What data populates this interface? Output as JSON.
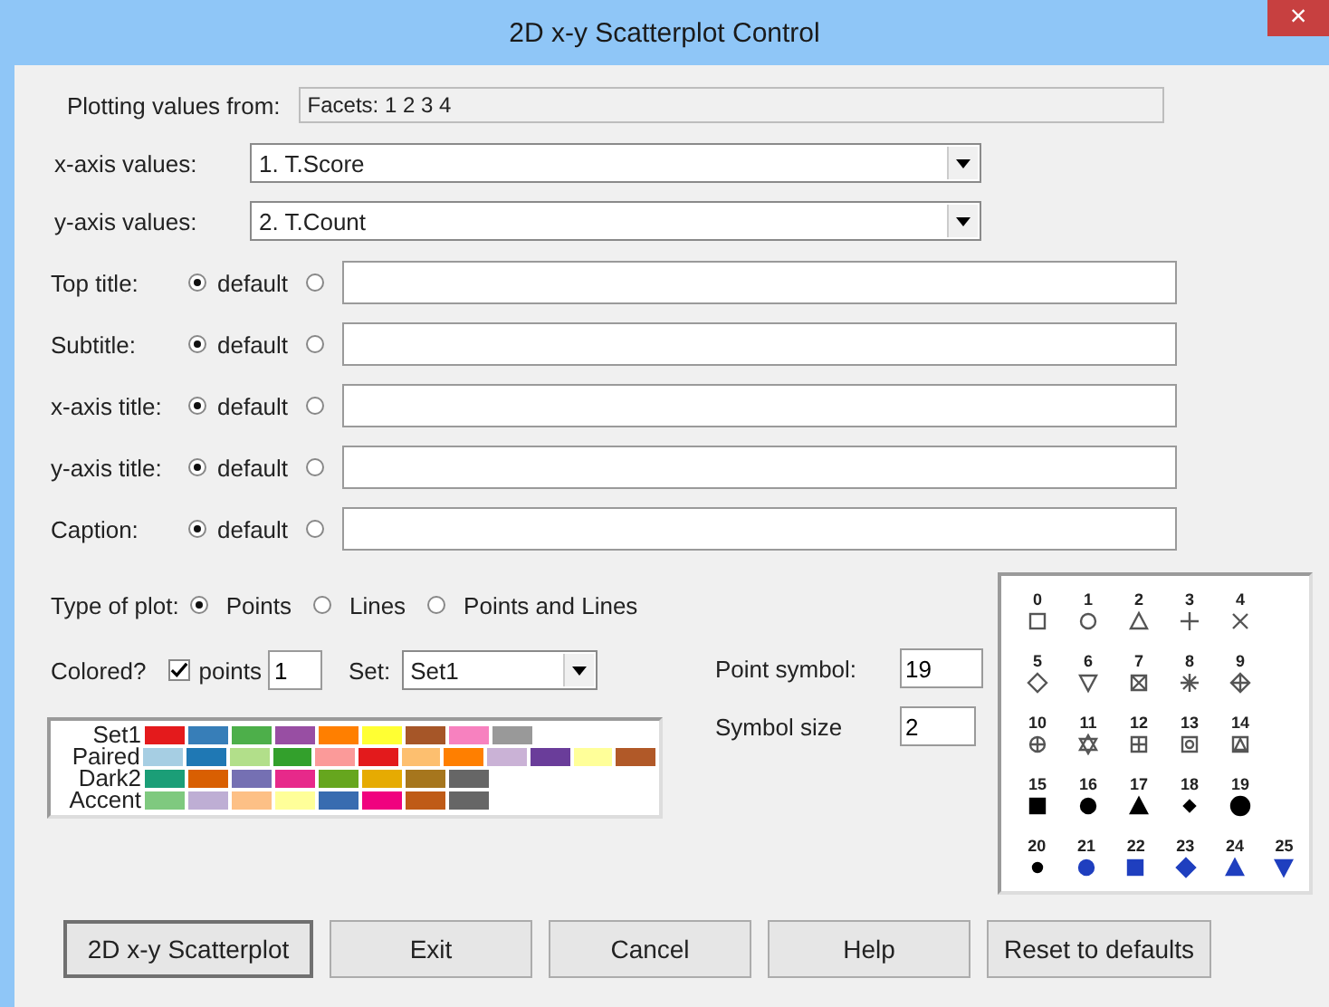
{
  "window": {
    "title": "2D x-y Scatterplot Control",
    "close": "×"
  },
  "source": {
    "label": "Plotting values from:",
    "value": "Facets: 1 2 3 4"
  },
  "axes": [
    {
      "label": "x-axis values:",
      "value": "1. T.Score"
    },
    {
      "label": "y-axis values:",
      "value": "2. T.Count"
    }
  ],
  "titles": [
    {
      "label": "Top title:",
      "default_label": "default",
      "default_selected": true,
      "custom_selected": false
    },
    {
      "label": "Subtitle:",
      "default_label": "default",
      "default_selected": true,
      "custom_selected": false
    },
    {
      "label": "x-axis title:",
      "default_label": "default",
      "default_selected": true,
      "custom_selected": false
    },
    {
      "label": "y-axis title:",
      "default_label": "default",
      "default_selected": true,
      "custom_selected": false
    },
    {
      "label": "Caption:",
      "default_label": "default",
      "default_selected": true,
      "custom_selected": false
    }
  ],
  "plot_type": {
    "label": "Type of plot:",
    "options": [
      {
        "label": "Points",
        "selected": true
      },
      {
        "label": "Lines",
        "selected": false
      },
      {
        "label": "Points and Lines",
        "selected": false
      }
    ]
  },
  "colored": {
    "label": "Colored?",
    "checkbox_label": "points",
    "checked": true,
    "count": "1",
    "set_label": "Set:",
    "set": "Set1"
  },
  "point_symbol": {
    "label": "Point symbol:",
    "value": "19"
  },
  "symbol_size": {
    "label": "Symbol size",
    "value": "2"
  },
  "palettes": [
    {
      "name": "Set1",
      "swatches": [
        {
          "color": "#e41a1c"
        },
        {
          "color": "#377eb8"
        },
        {
          "color": "#4daf4a"
        },
        {
          "color": "#984ea3"
        },
        {
          "color": "#ff7f00"
        },
        {
          "color": "#ffff33"
        },
        {
          "color": "#a65628"
        },
        {
          "color": "#f781bf"
        },
        {
          "color": "#999999"
        }
      ]
    },
    {
      "name": "Paired",
      "swatches": [
        {
          "color": "#a6cee3"
        },
        {
          "color": "#1f78b4"
        },
        {
          "color": "#b2df8a"
        },
        {
          "color": "#33a02c"
        },
        {
          "color": "#fb9a99"
        },
        {
          "color": "#e31a1c"
        },
        {
          "color": "#fdbf6f"
        },
        {
          "color": "#ff7f00"
        },
        {
          "color": "#cab2d6"
        },
        {
          "color": "#6a3d9a"
        },
        {
          "color": "#ffff99"
        },
        {
          "color": "#b15928"
        }
      ]
    },
    {
      "name": "Dark2",
      "swatches": [
        {
          "color": "#1b9e77"
        },
        {
          "color": "#d95f02"
        },
        {
          "color": "#7570b3"
        },
        {
          "color": "#e7298a"
        },
        {
          "color": "#66a61e"
        },
        {
          "color": "#e6ab02"
        },
        {
          "color": "#a6761d"
        },
        {
          "color": "#666666"
        }
      ]
    },
    {
      "name": "Accent",
      "swatches": [
        {
          "color": "#7fc97f"
        },
        {
          "color": "#beaed4"
        },
        {
          "color": "#fdc086"
        },
        {
          "color": "#ffff99"
        },
        {
          "color": "#386cb0"
        },
        {
          "color": "#f0027f"
        },
        {
          "color": "#bf5b17"
        },
        {
          "color": "#666666"
        }
      ]
    }
  ],
  "symbols": [
    [
      {
        "label": "0",
        "kind": "square-open",
        "color": "#555555"
      },
      {
        "label": "1",
        "kind": "circle-open",
        "color": "#555555"
      },
      {
        "label": "2",
        "kind": "triangle-open",
        "color": "#555555"
      },
      {
        "label": "3",
        "kind": "plus",
        "color": "#555555"
      },
      {
        "label": "4",
        "kind": "cross",
        "color": "#555555"
      }
    ],
    [
      {
        "label": "5",
        "kind": "diamond-open",
        "color": "#555555"
      },
      {
        "label": "6",
        "kind": "triangle-down-open",
        "color": "#555555"
      },
      {
        "label": "7",
        "kind": "square-cross",
        "color": "#555555"
      },
      {
        "label": "8",
        "kind": "asterisk",
        "color": "#555555"
      },
      {
        "label": "9",
        "kind": "diamond-plus",
        "color": "#555555"
      }
    ],
    [
      {
        "label": "10",
        "kind": "circle-plus",
        "color": "#555555"
      },
      {
        "label": "11",
        "kind": "star-open",
        "color": "#555555"
      },
      {
        "label": "12",
        "kind": "square-plus",
        "color": "#555555"
      },
      {
        "label": "13",
        "kind": "square-circle",
        "color": "#555555"
      },
      {
        "label": "14",
        "kind": "square-triangle",
        "color": "#555555"
      }
    ],
    [
      {
        "label": "15",
        "kind": "square",
        "color": "#000000"
      },
      {
        "label": "16",
        "kind": "circle",
        "color": "#000000"
      },
      {
        "label": "17",
        "kind": "triangle",
        "color": "#000000"
      },
      {
        "label": "18",
        "kind": "diamond-small",
        "color": "#000000"
      },
      {
        "label": "19",
        "kind": "circle-large",
        "color": "#000000"
      }
    ],
    [
      {
        "label": "20",
        "kind": "circle-small",
        "color": "#000000"
      },
      {
        "label": "21",
        "kind": "circle",
        "color": "#1f3fbf"
      },
      {
        "label": "22",
        "kind": "square",
        "color": "#1f3fbf"
      },
      {
        "label": "23",
        "kind": "diamond",
        "color": "#1f3fbf"
      },
      {
        "label": "24",
        "kind": "triangle",
        "color": "#1f3fbf"
      },
      {
        "label": "25",
        "kind": "triangle-down",
        "color": "#1f3fbf"
      }
    ]
  ],
  "buttons": [
    {
      "label": "2D x-y Scatterplot",
      "default": true
    },
    {
      "label": "Exit",
      "default": false
    },
    {
      "label": "Cancel",
      "default": false
    },
    {
      "label": "Help",
      "default": false
    },
    {
      "label": "Reset to defaults",
      "default": false
    }
  ]
}
